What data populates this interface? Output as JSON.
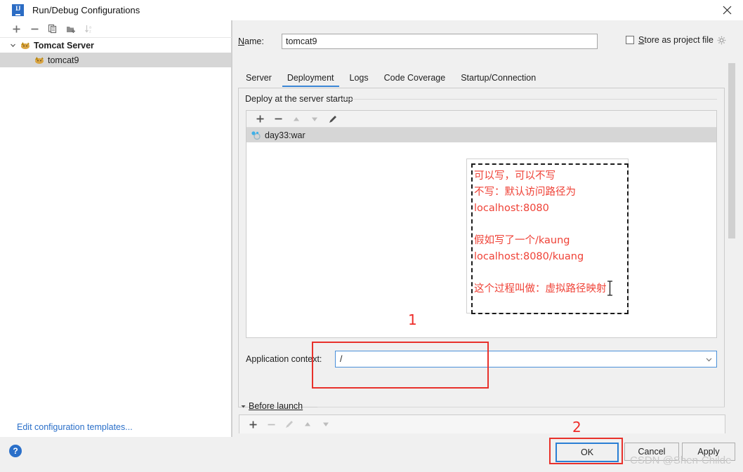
{
  "window": {
    "title": "Run/Debug Configurations",
    "logo_text": "IJ",
    "close_icon": "close-icon"
  },
  "sidebar": {
    "toolbar": [
      {
        "name": "add-configuration-button",
        "glyph": "+"
      },
      {
        "name": "remove-configuration-button",
        "glyph": "−"
      },
      {
        "name": "copy-configuration-button",
        "glyph": "copy-icon"
      },
      {
        "name": "new-folder-button",
        "glyph": "folder-add-icon"
      },
      {
        "name": "sort-configurations-button",
        "glyph": "sort-az-icon"
      }
    ],
    "tree": [
      {
        "label": "Tomcat Server",
        "type": "group",
        "expanded": true,
        "icon": "tomcat-icon"
      },
      {
        "label": "tomcat9",
        "type": "child",
        "selected": true,
        "icon": "tomcat-icon"
      }
    ],
    "edit_templates_link": "Edit configuration templates..."
  },
  "form": {
    "name_label": "Name:",
    "name_value": "tomcat9",
    "store_as_project_file_label": "Store as project file",
    "store_as_project_file_checked": false,
    "gear_icon": "gear-icon"
  },
  "tabs": [
    {
      "label": "Server",
      "active": false
    },
    {
      "label": "Deployment",
      "active": true
    },
    {
      "label": "Logs",
      "active": false
    },
    {
      "label": "Code Coverage",
      "active": false
    },
    {
      "label": "Startup/Connection",
      "active": false
    }
  ],
  "deployment": {
    "group_legend": "Deploy at the server startup",
    "list_toolbar": [
      {
        "name": "add-artifact-button",
        "glyph": "+"
      },
      {
        "name": "remove-artifact-button",
        "glyph": "−"
      },
      {
        "name": "move-up-button",
        "glyph": "triangle-up-icon"
      },
      {
        "name": "move-down-button",
        "glyph": "triangle-down-icon"
      },
      {
        "name": "edit-artifact-button",
        "glyph": "pencil-icon"
      }
    ],
    "artifacts": [
      {
        "label": "day33:war",
        "icon": "artifact-icon",
        "selected": true
      }
    ],
    "application_context_label": "Application context:",
    "application_context_value": "/",
    "combo_arrow_icon": "chevron-down-icon"
  },
  "before_launch": {
    "label": "Before launch",
    "expanded": true,
    "toolbar": [
      {
        "name": "add-task-button",
        "glyph": "+"
      },
      {
        "name": "remove-task-button",
        "glyph": "−"
      },
      {
        "name": "edit-task-button",
        "glyph": "pencil-icon"
      },
      {
        "name": "task-move-up-button",
        "glyph": "triangle-up-icon"
      },
      {
        "name": "task-move-down-button",
        "glyph": "triangle-down-icon"
      }
    ]
  },
  "footer": {
    "help_glyph": "?",
    "ok_label": "OK",
    "cancel_label": "Cancel",
    "apply_label": "Apply"
  },
  "annotations": {
    "note_text": "可以写，可以不写\n不写：默认访问路径为\nlocalhost:8080\n\n假如写了一个/kaung\nlocalhost:8080/kuang\n\n这个过程叫做：虚拟路径映射",
    "marker_one": "1",
    "marker_two": "2",
    "note_color": "#ef4136",
    "box_color": "#e8312b"
  },
  "watermark": "CSDN @Shen-Childe"
}
